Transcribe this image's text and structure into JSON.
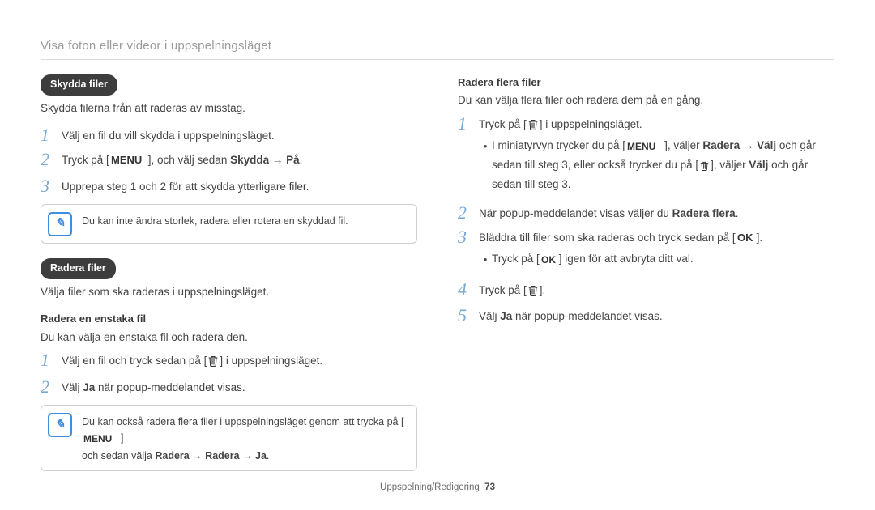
{
  "header": {
    "title": "Visa foton eller videor i uppspelningsläget"
  },
  "left": {
    "protect": {
      "pill": "Skydda filer",
      "lede": "Skydda filerna från att raderas av misstag.",
      "steps": {
        "s1": "Välj en fil du vill skydda i uppspelningsläget.",
        "s2_pre": "Tryck på [",
        "s2_mid": "], och välj sedan ",
        "s2_bold": "Skydda → På",
        "s2_post": ".",
        "s3": "Upprepa steg 1 och 2 för att skydda ytterligare filer."
      },
      "note": "Du kan inte ändra storlek, radera eller rotera en skyddad fil."
    },
    "delete": {
      "pill": "Radera filer",
      "lede": "Välja filer som ska raderas i uppspelningsläget.",
      "single": {
        "heading": "Radera en enstaka fil",
        "lede": "Du kan välja en enstaka fil och radera den.",
        "s1_pre": "Välj en fil och tryck sedan på [",
        "s1_post": "] i uppspelningsläget.",
        "s2_pre": "Välj ",
        "s2_bold": "Ja",
        "s2_post": " när popup-meddelandet visas."
      },
      "note": {
        "line1_pre": "Du kan också radera flera filer i uppspelningsläget genom att trycka på [",
        "line1_post": "]",
        "line2_pre": "och sedan välja ",
        "line2_bold": "Radera → Radera → Ja",
        "line2_post": "."
      }
    }
  },
  "right": {
    "multi": {
      "heading": "Radera flera filer",
      "lede": "Du kan välja flera filer och radera dem på en gång.",
      "s1_pre": "Tryck på [",
      "s1_post": "] i uppspelningsläget.",
      "bullet1_pre": "I miniatyrvyn trycker du på [",
      "bullet1_mid1": "], väljer ",
      "bullet1_bold1": "Radera → Välj",
      "bullet1_mid2": " och går sedan till steg 3, eller också trycker du på [",
      "bullet1_mid3": "], väljer ",
      "bullet1_bold2": "Välj",
      "bullet1_post": " och går sedan till steg 3.",
      "s2_pre": "När popup-meddelandet visas väljer du ",
      "s2_bold": "Radera flera",
      "s2_post": ".",
      "s3_pre": "Bläddra till filer som ska raderas och tryck sedan på [",
      "s3_post": "].",
      "bullet3_pre": "Tryck på [",
      "bullet3_post": "] igen för att avbryta ditt val.",
      "s4_pre": "Tryck på [",
      "s4_post": "].",
      "s5_pre": "Välj ",
      "s5_bold": "Ja",
      "s5_post": " när popup-meddelandet visas."
    }
  },
  "footer": {
    "section": "Uppspelning/Redigering",
    "page": "73"
  }
}
